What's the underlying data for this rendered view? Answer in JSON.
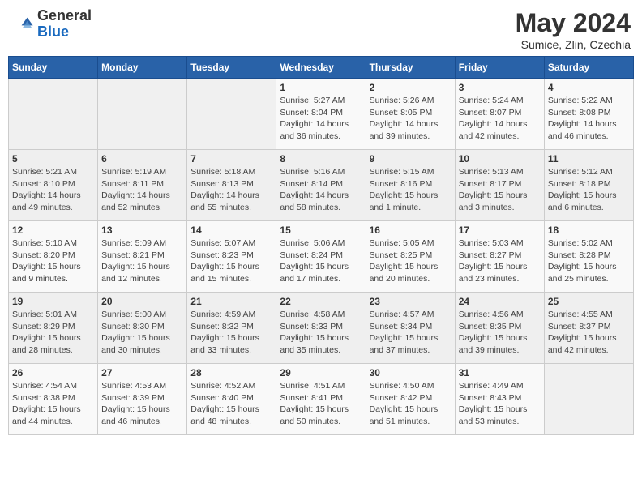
{
  "header": {
    "logo_general": "General",
    "logo_blue": "Blue",
    "month": "May 2024",
    "location": "Sumice, Zlin, Czechia"
  },
  "weekdays": [
    "Sunday",
    "Monday",
    "Tuesday",
    "Wednesday",
    "Thursday",
    "Friday",
    "Saturday"
  ],
  "weeks": [
    [
      {
        "day": "",
        "sunrise": "",
        "sunset": "",
        "daylight": ""
      },
      {
        "day": "",
        "sunrise": "",
        "sunset": "",
        "daylight": ""
      },
      {
        "day": "",
        "sunrise": "",
        "sunset": "",
        "daylight": ""
      },
      {
        "day": "1",
        "sunrise": "Sunrise: 5:27 AM",
        "sunset": "Sunset: 8:04 PM",
        "daylight": "Daylight: 14 hours and 36 minutes."
      },
      {
        "day": "2",
        "sunrise": "Sunrise: 5:26 AM",
        "sunset": "Sunset: 8:05 PM",
        "daylight": "Daylight: 14 hours and 39 minutes."
      },
      {
        "day": "3",
        "sunrise": "Sunrise: 5:24 AM",
        "sunset": "Sunset: 8:07 PM",
        "daylight": "Daylight: 14 hours and 42 minutes."
      },
      {
        "day": "4",
        "sunrise": "Sunrise: 5:22 AM",
        "sunset": "Sunset: 8:08 PM",
        "daylight": "Daylight: 14 hours and 46 minutes."
      }
    ],
    [
      {
        "day": "5",
        "sunrise": "Sunrise: 5:21 AM",
        "sunset": "Sunset: 8:10 PM",
        "daylight": "Daylight: 14 hours and 49 minutes."
      },
      {
        "day": "6",
        "sunrise": "Sunrise: 5:19 AM",
        "sunset": "Sunset: 8:11 PM",
        "daylight": "Daylight: 14 hours and 52 minutes."
      },
      {
        "day": "7",
        "sunrise": "Sunrise: 5:18 AM",
        "sunset": "Sunset: 8:13 PM",
        "daylight": "Daylight: 14 hours and 55 minutes."
      },
      {
        "day": "8",
        "sunrise": "Sunrise: 5:16 AM",
        "sunset": "Sunset: 8:14 PM",
        "daylight": "Daylight: 14 hours and 58 minutes."
      },
      {
        "day": "9",
        "sunrise": "Sunrise: 5:15 AM",
        "sunset": "Sunset: 8:16 PM",
        "daylight": "Daylight: 15 hours and 1 minute."
      },
      {
        "day": "10",
        "sunrise": "Sunrise: 5:13 AM",
        "sunset": "Sunset: 8:17 PM",
        "daylight": "Daylight: 15 hours and 3 minutes."
      },
      {
        "day": "11",
        "sunrise": "Sunrise: 5:12 AM",
        "sunset": "Sunset: 8:18 PM",
        "daylight": "Daylight: 15 hours and 6 minutes."
      }
    ],
    [
      {
        "day": "12",
        "sunrise": "Sunrise: 5:10 AM",
        "sunset": "Sunset: 8:20 PM",
        "daylight": "Daylight: 15 hours and 9 minutes."
      },
      {
        "day": "13",
        "sunrise": "Sunrise: 5:09 AM",
        "sunset": "Sunset: 8:21 PM",
        "daylight": "Daylight: 15 hours and 12 minutes."
      },
      {
        "day": "14",
        "sunrise": "Sunrise: 5:07 AM",
        "sunset": "Sunset: 8:23 PM",
        "daylight": "Daylight: 15 hours and 15 minutes."
      },
      {
        "day": "15",
        "sunrise": "Sunrise: 5:06 AM",
        "sunset": "Sunset: 8:24 PM",
        "daylight": "Daylight: 15 hours and 17 minutes."
      },
      {
        "day": "16",
        "sunrise": "Sunrise: 5:05 AM",
        "sunset": "Sunset: 8:25 PM",
        "daylight": "Daylight: 15 hours and 20 minutes."
      },
      {
        "day": "17",
        "sunrise": "Sunrise: 5:03 AM",
        "sunset": "Sunset: 8:27 PM",
        "daylight": "Daylight: 15 hours and 23 minutes."
      },
      {
        "day": "18",
        "sunrise": "Sunrise: 5:02 AM",
        "sunset": "Sunset: 8:28 PM",
        "daylight": "Daylight: 15 hours and 25 minutes."
      }
    ],
    [
      {
        "day": "19",
        "sunrise": "Sunrise: 5:01 AM",
        "sunset": "Sunset: 8:29 PM",
        "daylight": "Daylight: 15 hours and 28 minutes."
      },
      {
        "day": "20",
        "sunrise": "Sunrise: 5:00 AM",
        "sunset": "Sunset: 8:30 PM",
        "daylight": "Daylight: 15 hours and 30 minutes."
      },
      {
        "day": "21",
        "sunrise": "Sunrise: 4:59 AM",
        "sunset": "Sunset: 8:32 PM",
        "daylight": "Daylight: 15 hours and 33 minutes."
      },
      {
        "day": "22",
        "sunrise": "Sunrise: 4:58 AM",
        "sunset": "Sunset: 8:33 PM",
        "daylight": "Daylight: 15 hours and 35 minutes."
      },
      {
        "day": "23",
        "sunrise": "Sunrise: 4:57 AM",
        "sunset": "Sunset: 8:34 PM",
        "daylight": "Daylight: 15 hours and 37 minutes."
      },
      {
        "day": "24",
        "sunrise": "Sunrise: 4:56 AM",
        "sunset": "Sunset: 8:35 PM",
        "daylight": "Daylight: 15 hours and 39 minutes."
      },
      {
        "day": "25",
        "sunrise": "Sunrise: 4:55 AM",
        "sunset": "Sunset: 8:37 PM",
        "daylight": "Daylight: 15 hours and 42 minutes."
      }
    ],
    [
      {
        "day": "26",
        "sunrise": "Sunrise: 4:54 AM",
        "sunset": "Sunset: 8:38 PM",
        "daylight": "Daylight: 15 hours and 44 minutes."
      },
      {
        "day": "27",
        "sunrise": "Sunrise: 4:53 AM",
        "sunset": "Sunset: 8:39 PM",
        "daylight": "Daylight: 15 hours and 46 minutes."
      },
      {
        "day": "28",
        "sunrise": "Sunrise: 4:52 AM",
        "sunset": "Sunset: 8:40 PM",
        "daylight": "Daylight: 15 hours and 48 minutes."
      },
      {
        "day": "29",
        "sunrise": "Sunrise: 4:51 AM",
        "sunset": "Sunset: 8:41 PM",
        "daylight": "Daylight: 15 hours and 50 minutes."
      },
      {
        "day": "30",
        "sunrise": "Sunrise: 4:50 AM",
        "sunset": "Sunset: 8:42 PM",
        "daylight": "Daylight: 15 hours and 51 minutes."
      },
      {
        "day": "31",
        "sunrise": "Sunrise: 4:49 AM",
        "sunset": "Sunset: 8:43 PM",
        "daylight": "Daylight: 15 hours and 53 minutes."
      },
      {
        "day": "",
        "sunrise": "",
        "sunset": "",
        "daylight": ""
      }
    ]
  ]
}
